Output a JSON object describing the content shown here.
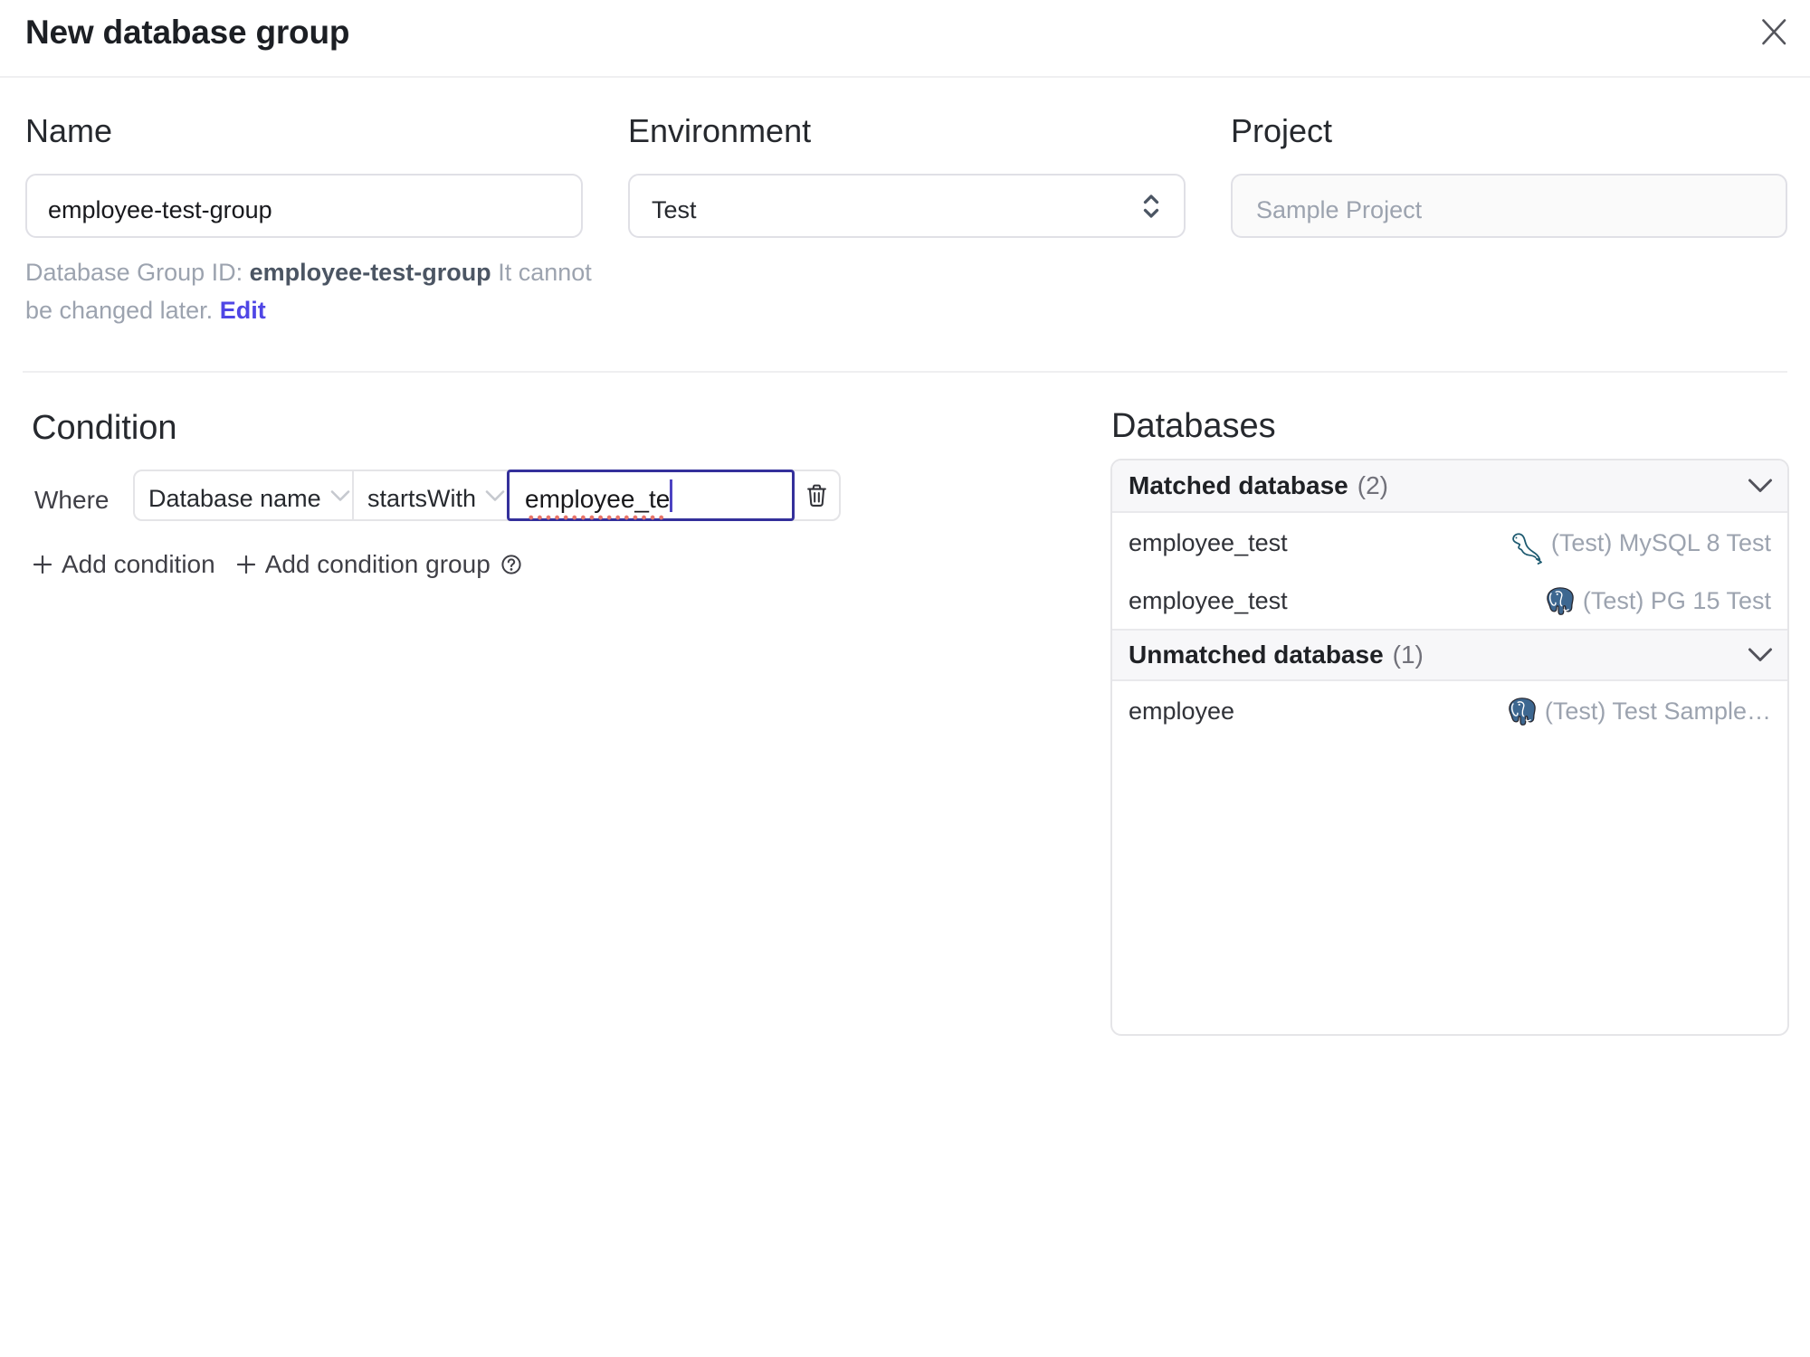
{
  "dialog": {
    "title": "New database group"
  },
  "form": {
    "name": {
      "label": "Name",
      "value": "employee-test-group"
    },
    "environment": {
      "label": "Environment",
      "value": "Test"
    },
    "project": {
      "label": "Project",
      "value": "Sample Project"
    },
    "id_help": {
      "prefix": "Database Group ID: ",
      "id": "employee-test-group",
      "suffix": " It cannot be changed later.",
      "edit_label": "Edit"
    }
  },
  "condition": {
    "heading": "Condition",
    "where_label": "Where",
    "factor": "Database name",
    "operator": "startsWith",
    "value": "employee_te",
    "add_condition_label": "Add condition",
    "add_condition_group_label": "Add condition group"
  },
  "databases": {
    "heading": "Databases",
    "groups": [
      {
        "label": "Matched database",
        "count": "(2)",
        "rows": [
          {
            "name": "employee_test",
            "instance": "(Test) MySQL 8 Test",
            "engine": "mysql"
          },
          {
            "name": "employee_test",
            "instance": "(Test) PG 15 Test",
            "engine": "postgres"
          }
        ]
      },
      {
        "label": "Unmatched database",
        "count": "(1)",
        "rows": [
          {
            "name": "employee",
            "instance": "(Test) Test Sample…",
            "engine": "postgres"
          }
        ]
      }
    ]
  },
  "colors": {
    "accent": "#4f46e5",
    "focus_border": "#34309b",
    "spellcheck": "#e9705e",
    "panel_header_bg": "#f7f7f9",
    "border": "#e0e0e6"
  }
}
